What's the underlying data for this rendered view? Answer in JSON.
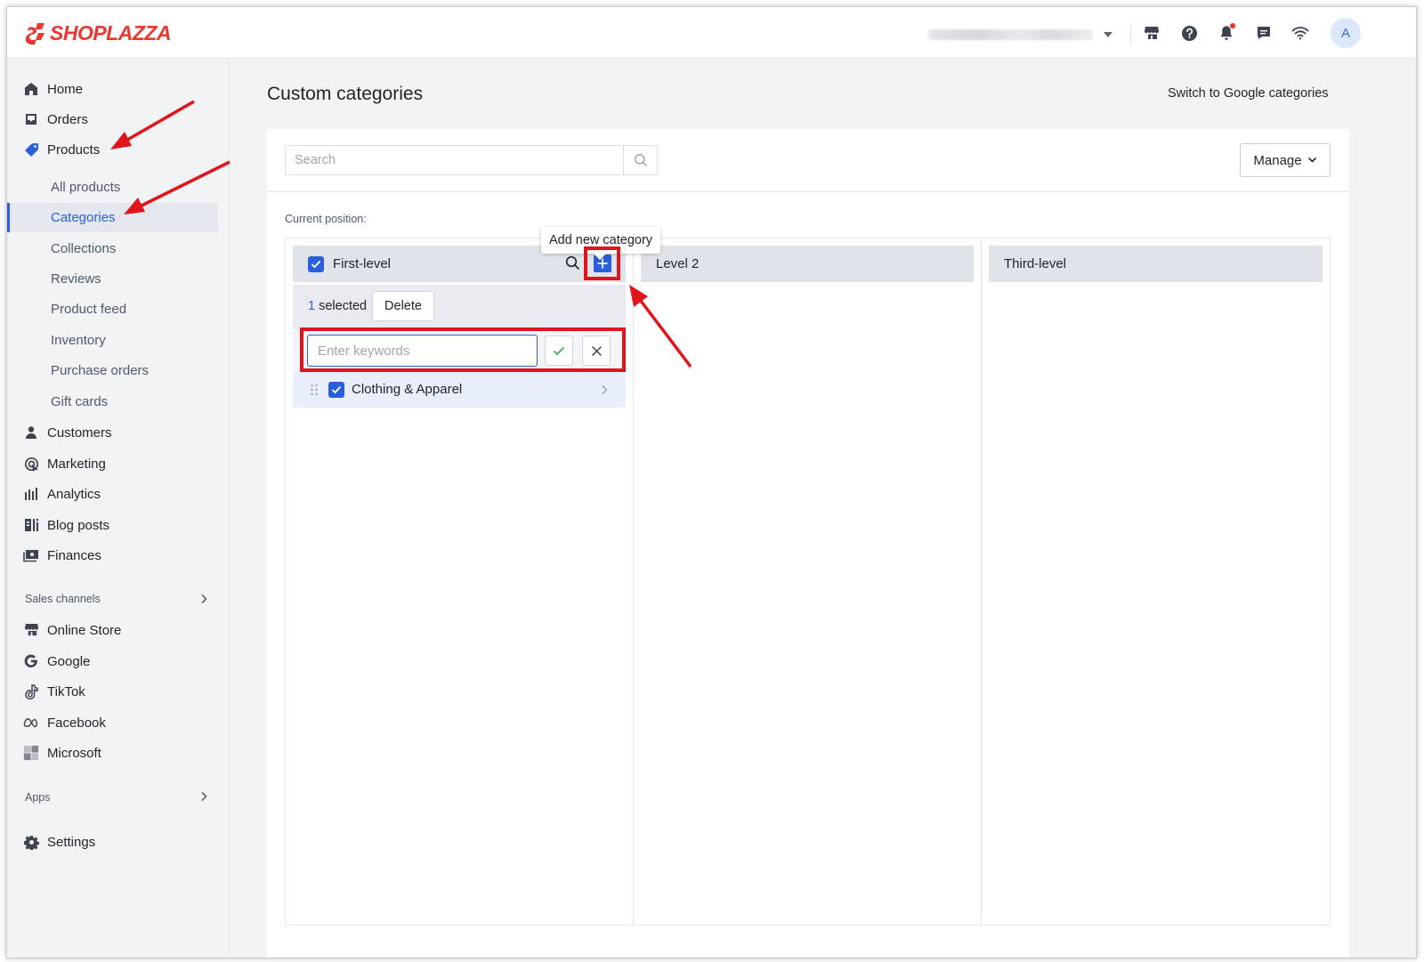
{
  "app": {
    "logo_text": "SHOPLAZZA",
    "brand_color": "#e8382f",
    "accent_color": "#2a5fdb"
  },
  "topbar": {
    "avatar_letter": "A",
    "icons": [
      "store-icon",
      "help-icon",
      "bell-icon",
      "chat-icon",
      "wifi-icon"
    ]
  },
  "sidebar": {
    "items": [
      {
        "label": "Home",
        "icon": "home-icon"
      },
      {
        "label": "Orders",
        "icon": "orders-icon"
      },
      {
        "label": "Products",
        "icon": "tag-icon"
      },
      {
        "label": "Customers",
        "icon": "person-icon"
      },
      {
        "label": "Marketing",
        "icon": "marketing-icon"
      },
      {
        "label": "Analytics",
        "icon": "analytics-icon"
      },
      {
        "label": "Blog posts",
        "icon": "blog-icon"
      },
      {
        "label": "Finances",
        "icon": "finances-icon"
      }
    ],
    "products_sub": [
      "All products",
      "Categories",
      "Collections",
      "Reviews",
      "Product feed",
      "Inventory",
      "Purchase orders",
      "Gift cards"
    ],
    "active_sub": "Categories",
    "sales_channels_label": "Sales channels",
    "channels": [
      {
        "label": "Online Store",
        "icon": "store-icon"
      },
      {
        "label": "Google",
        "icon": "google-icon"
      },
      {
        "label": "TikTok",
        "icon": "tiktok-icon"
      },
      {
        "label": "Facebook",
        "icon": "meta-icon"
      },
      {
        "label": "Microsoft",
        "icon": "microsoft-icon"
      }
    ],
    "apps_label": "Apps",
    "settings_label": "Settings"
  },
  "main": {
    "title": "Custom categories",
    "switch_link": "Switch to Google categories",
    "search_placeholder": "Search",
    "manage_label": "Manage",
    "current_position_label": "Current position:",
    "columns": [
      "First-level",
      "Level 2",
      "Third-level"
    ],
    "selected_count": "1",
    "selected_suffix": " selected",
    "delete_label": "Delete",
    "keyword_placeholder": "Enter keywords",
    "tooltip": "Add new category",
    "categories": [
      {
        "label": "Clothing & Apparel",
        "checked": true
      }
    ]
  }
}
